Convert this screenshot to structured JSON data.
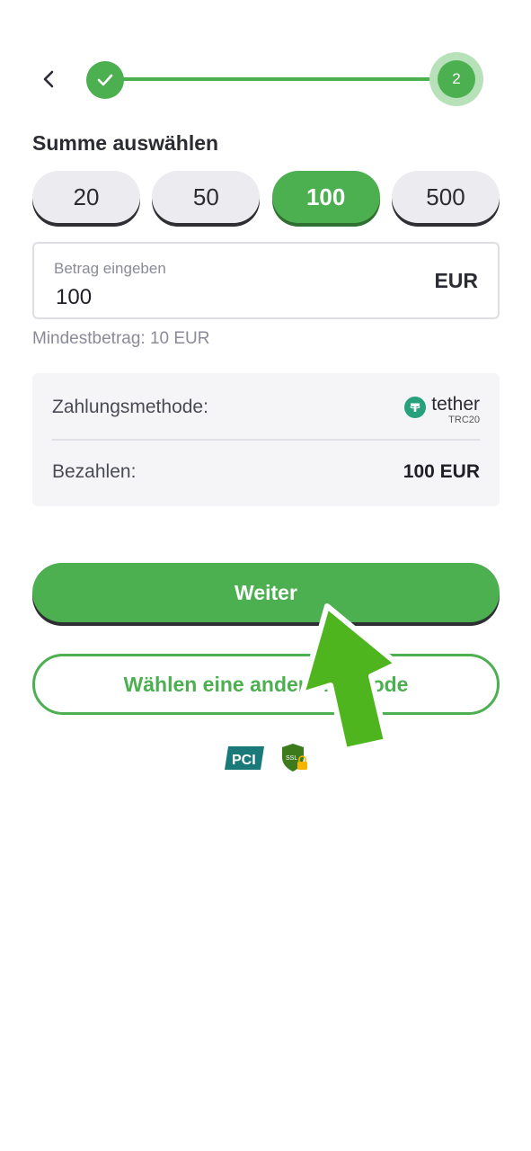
{
  "stepper": {
    "current_step": "2"
  },
  "section_title": "Summe auswählen",
  "amount_options": [
    "20",
    "50",
    "100",
    "500"
  ],
  "selected_amount": "100",
  "amount_field": {
    "label": "Betrag eingeben",
    "value": "100",
    "currency": "EUR"
  },
  "min_amount": "Mindestbetrag: 10 EUR",
  "summary": {
    "method_label": "Zahlungsmethode:",
    "method_name": "tether",
    "method_network": "TRC20",
    "pay_label": "Bezahlen:",
    "pay_value": "100 EUR"
  },
  "buttons": {
    "continue": "Weiter",
    "other_method": "Wählen eine andere Methode"
  },
  "badges": {
    "pci": "PCI",
    "ssl": "SSL"
  },
  "colors": {
    "accent": "#4caf50",
    "tether": "#26a17b"
  }
}
